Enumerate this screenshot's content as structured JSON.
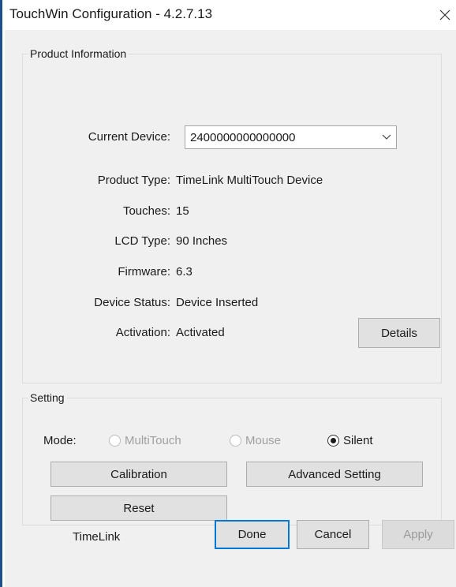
{
  "window": {
    "title": "TouchWin Configuration - 4.2.7.13",
    "close_glyph": "✕"
  },
  "product": {
    "legend": "Product Information",
    "current_device_label": "Current Device:",
    "current_device_value": "2400000000000000",
    "rows": [
      {
        "label": "Product Type:",
        "value": "TimeLink MultiTouch Device"
      },
      {
        "label": "Touches:",
        "value": "15"
      },
      {
        "label": "LCD Type:",
        "value": "90 Inches"
      },
      {
        "label": "Firmware:",
        "value": "6.3"
      },
      {
        "label": "Device Status:",
        "value": "Device Inserted"
      },
      {
        "label": "Activation:",
        "value": "Activated"
      }
    ],
    "details_label": "Details"
  },
  "setting": {
    "legend": "Setting",
    "mode_label": "Mode:",
    "modes": [
      {
        "label": "MultiTouch",
        "enabled": false,
        "checked": false
      },
      {
        "label": "Mouse",
        "enabled": false,
        "checked": false
      },
      {
        "label": "Silent",
        "enabled": true,
        "checked": true
      }
    ],
    "calibration_label": "Calibration",
    "advanced_label": "Advanced Setting",
    "reset_label": "Reset"
  },
  "footer": {
    "brand": "TimeLink",
    "done_label": "Done",
    "cancel_label": "Cancel",
    "apply_label": "Apply"
  },
  "colors": {
    "accent": "#0078d7",
    "window_border": "#1f4e8c",
    "background": "#f0f0f0"
  }
}
